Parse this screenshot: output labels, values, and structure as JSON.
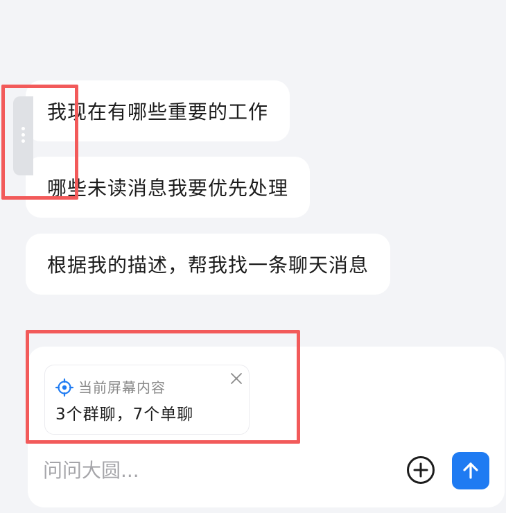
{
  "suggestions": [
    {
      "label": "我现在有哪些重要的工作"
    },
    {
      "label": "哪些未读消息我要优先处理"
    },
    {
      "label": "根据我的描述，帮我找一条聊天消息"
    }
  ],
  "context_card": {
    "icon": "target-icon",
    "title": "当前屏幕内容",
    "summary": "3个群聊，7个单聊"
  },
  "composer": {
    "placeholder": "问问大圆...",
    "value": ""
  },
  "colors": {
    "accent": "#1f7bf2",
    "highlight": "#f25a5a",
    "background": "#f3f4f7"
  }
}
